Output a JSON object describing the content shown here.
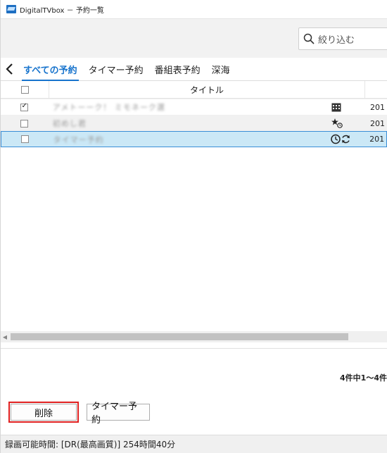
{
  "window": {
    "title": "DigitalTVbox － 予約一覧"
  },
  "search": {
    "placeholder": "絞り込む"
  },
  "tabs": [
    {
      "label": "すべての予約",
      "active": true
    },
    {
      "label": "タイマー予約",
      "active": false
    },
    {
      "label": "番組表予約",
      "active": false
    },
    {
      "label": "深海",
      "active": false
    }
  ],
  "table": {
    "header_title": "タイトル",
    "rows": [
      {
        "checked": true,
        "title": "アメトーーク！ ミモネーク選",
        "icon": "calendar-grid-icon",
        "date": "201"
      },
      {
        "checked": false,
        "title": "初めし君",
        "icon": "star-clock-icon",
        "date": "201"
      },
      {
        "checked": false,
        "title": "タイマー予約",
        "icon": "clock-repeat-icon",
        "date": "201",
        "selected": true
      }
    ]
  },
  "count_text": "4件中1～4件",
  "buttons": {
    "delete": "削除",
    "timer": "タイマー予約"
  },
  "status": {
    "text": "録画可能時間: [DR(最高画質)] 254時間40分"
  },
  "colors": {
    "accent": "#1874cd",
    "selected_row": "#cbe8f6",
    "highlight_box": "#e02020"
  }
}
